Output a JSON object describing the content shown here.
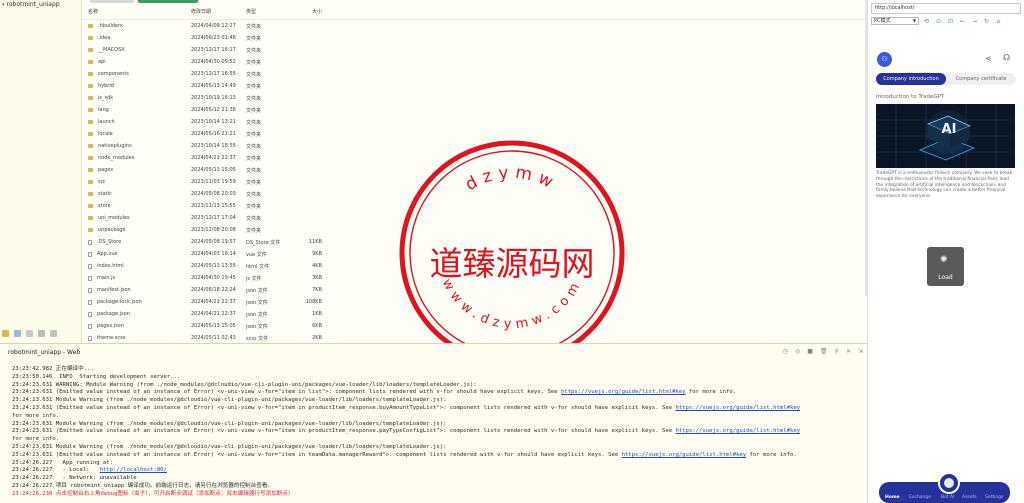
{
  "project": {
    "root_label": "robotmint_uniapp",
    "footer_icons": [
      "folder-icon",
      "image-icon",
      "doc-icon",
      "window-icon",
      "history-icon"
    ]
  },
  "files": {
    "columns": [
      "名称",
      "修改日期",
      "类型",
      "大小"
    ],
    "rows": [
      {
        "name": ".hbuilderx",
        "date": "2024/04/09 12:27",
        "type": "文件夹",
        "size": "",
        "kind": "folder"
      },
      {
        "name": ".idea",
        "date": "2024/06/23 01:46",
        "type": "文件夹",
        "size": "",
        "kind": "folder"
      },
      {
        "name": "__MACOSX",
        "date": "2023/12/17 16:17",
        "type": "文件夹",
        "size": "",
        "kind": "folder"
      },
      {
        "name": "api",
        "date": "2024/04/30 09:52",
        "type": "文件夹",
        "size": "",
        "kind": "folder"
      },
      {
        "name": "components",
        "date": "2023/12/17 16:55",
        "type": "文件夹",
        "size": "",
        "kind": "folder"
      },
      {
        "name": "hybrid",
        "date": "2024/05/13 14:49",
        "type": "文件夹",
        "size": "",
        "kind": "folder"
      },
      {
        "name": "js_sdk",
        "date": "2023/10/19 16:13",
        "type": "文件夹",
        "size": "",
        "kind": "folder"
      },
      {
        "name": "lang",
        "date": "2024/05/12 21:36",
        "type": "文件夹",
        "size": "",
        "kind": "folder"
      },
      {
        "name": "launch",
        "date": "2023/10/14 13:21",
        "type": "文件夹",
        "size": "",
        "kind": "folder"
      },
      {
        "name": "locale",
        "date": "2024/05/16 21:21",
        "type": "文件夹",
        "size": "",
        "kind": "folder"
      },
      {
        "name": "nativeplugins",
        "date": "2023/10/14 18:55",
        "type": "文件夹",
        "size": "",
        "kind": "folder"
      },
      {
        "name": "node_modules",
        "date": "2024/04/21 22:37",
        "type": "文件夹",
        "size": "",
        "kind": "folder"
      },
      {
        "name": "pages",
        "date": "2024/05/13 15:05",
        "type": "文件夹",
        "size": "",
        "kind": "folder"
      },
      {
        "name": "src",
        "date": "2023/11/03 19:59",
        "type": "文件夹",
        "size": "",
        "kind": "folder"
      },
      {
        "name": "static",
        "date": "2024/05/08 20:03",
        "type": "文件夹",
        "size": "",
        "kind": "folder"
      },
      {
        "name": "store",
        "date": "2023/11/13 15:55",
        "type": "文件夹",
        "size": "",
        "kind": "folder"
      },
      {
        "name": "uni_modules",
        "date": "2023/12/17 17:04",
        "type": "文件夹",
        "size": "",
        "kind": "folder"
      },
      {
        "name": "unpackage",
        "date": "2023/12/08 20:08",
        "type": "文件夹",
        "size": "",
        "kind": "folder"
      },
      {
        "name": ".DS_Store",
        "date": "2024/05/08 19:57",
        "type": "DS_Store 文件",
        "size": "11KB",
        "kind": "file"
      },
      {
        "name": "App.vue",
        "date": "2024/04/03 16:14",
        "type": "vue 文件",
        "size": "9KB",
        "kind": "file"
      },
      {
        "name": "index.html",
        "date": "2024/05/13 13:55",
        "type": "html 文件",
        "size": "4KB",
        "kind": "file"
      },
      {
        "name": "main.js",
        "date": "2024/04/30 19:45",
        "type": "js 文件",
        "size": "3KB",
        "kind": "file"
      },
      {
        "name": "manifest.json",
        "date": "2024/06/18 22:24",
        "type": "json 文件",
        "size": "7KB",
        "kind": "file"
      },
      {
        "name": "package-lock.json",
        "date": "2024/04/21 22:37",
        "type": "json 文件",
        "size": "108KB",
        "kind": "file"
      },
      {
        "name": "package.json",
        "date": "2024/04/21 22:37",
        "type": "json 文件",
        "size": "1KB",
        "kind": "file"
      },
      {
        "name": "pages.json",
        "date": "2024/05/13 15:05",
        "type": "json 文件",
        "size": "6KB",
        "kind": "file"
      },
      {
        "name": "theme.scss",
        "date": "2024/05/11 02:43",
        "type": "scss 文件",
        "size": "2KB",
        "kind": "file"
      }
    ]
  },
  "stamp": {
    "center_text": "道臻源码网",
    "ring_text": "www.dzymw.com",
    "color": "#e0141e"
  },
  "console": {
    "title": "robotmint_uniapp - Web",
    "tool_icons": [
      "clock-icon",
      "target-icon",
      "stop-icon",
      "trash-icon",
      "filter-icon",
      "close-icon",
      "collapse-icon"
    ],
    "lines": [
      {
        "t": "23:23:42.982 正在编译中...",
        "cls": "cn"
      },
      {
        "t": "23:23:50.146  INFO  Starting development server...",
        "cls": "cn"
      },
      {
        "t": "23:24:23.631 WARNING: Module Warning (from ./node_modules/@dcloudio/vue-cli-plugin-uni/packages/vue-loader/lib/loaders/templateLoader.js):",
        "cls": "cn"
      },
      {
        "t": "23:24:23.631 (Emitted value instead of an instance of Error) <v-uni-view v-for=\"item in list\">: component lists rendered with v-for should have explicit keys. See ",
        "link": "https://vuejs.org/guide/list.html#key",
        "tail": " for more info.",
        "cls": "cn"
      },
      {
        "t": "23:24:23.631 Module Warning (from ./node_modules/@dcloudio/vue-cli-plugin-uni/packages/vue-loader/lib/loaders/templateLoader.js):",
        "cls": "cn"
      },
      {
        "t": "23:24:23.631 (Emitted value instead of an instance of Error) <v-uni-view v-for=\"item in productItem_response.buyAmountTypeList\">: component lists rendered with v-for should have explicit keys. See ",
        "link": "https://vuejs.org/guide/list.html#key",
        "tail": "",
        "cls": "cn"
      },
      {
        "t": "for more info.",
        "cls": "cn"
      },
      {
        "t": "23:24:23.631 Module Warning (from ./node_modules/@dcloudio/vue-cli-plugin-uni/packages/vue-loader/lib/loaders/templateLoader.js):",
        "cls": "cn"
      },
      {
        "t": "23:24:23.631 (Emitted value instead of an instance of Error) <v-uni-view v-for=\"item in productItem_response.payTypeConfigList\">: component lists rendered with v-for should have explicit keys. See ",
        "link": "https://vuejs.org/guide/list.html#key",
        "tail": "",
        "cls": "cn"
      },
      {
        "t": "for more info.",
        "cls": "cn"
      },
      {
        "t": "23:24:23.631 Module Warning (from ./node_modules/@dcloudio/vue-cli-plugin-uni/packages/vue-loader/lib/loaders/templateLoader.js):",
        "cls": "cn"
      },
      {
        "t": "23:24:23.631 (Emitted value instead of an instance of Error) <v-uni-view v-for=\"item in teamData.managerReward\">: component lists rendered with v-for should have explicit keys. See ",
        "link": "https://vuejs.org/guide/list.html#key",
        "tail": " for more info.",
        "cls": "cn"
      },
      {
        "t": "23:24:26.227   App running at:",
        "cls": "cn"
      },
      {
        "t": "23:24:26.227   - Local:   ",
        "link": "http://localhost:80/",
        "tail": "",
        "cls": "cn"
      },
      {
        "t": "23:24:26.227   - Network: unavailable",
        "cls": "cn"
      },
      {
        "t": "23:24:26.227 项目 robotmint_uniapp 编译成功。前端运行日志，请另行在浏览器的控制台查看。",
        "cls": "cn"
      },
      {
        "t": "23:24:26.230 点击控制台右上角debug图标（虫子），可开启断点调试（添加断点：双击编辑器行号添加断点）",
        "cls": "warn"
      }
    ]
  },
  "simulator": {
    "url": "http://localhost/",
    "device": "PC模式",
    "toolbar_icons": [
      "rotate-icon",
      "screenshot-icon",
      "record-icon",
      "back-icon",
      "forward-icon",
      "refresh-icon",
      "home-icon"
    ],
    "tab_active": "Company introduction",
    "tab_inactive": "Company certificate",
    "intro_heading": "Introduction to TradeGPT",
    "hero_text": "AI",
    "description": "TradeGPT is a enthusiastic fintech company. We seek to break through the restrictions of the traditional financial field, lead the integration of artificial intelligence and blockchain, and firmly believe that technology can create a better financial experience for everyone.",
    "loading_label": "Load",
    "nav": [
      "Home",
      "Exchange",
      "Bot AI",
      "Assets",
      "Settings"
    ],
    "accent": "#27319b"
  }
}
